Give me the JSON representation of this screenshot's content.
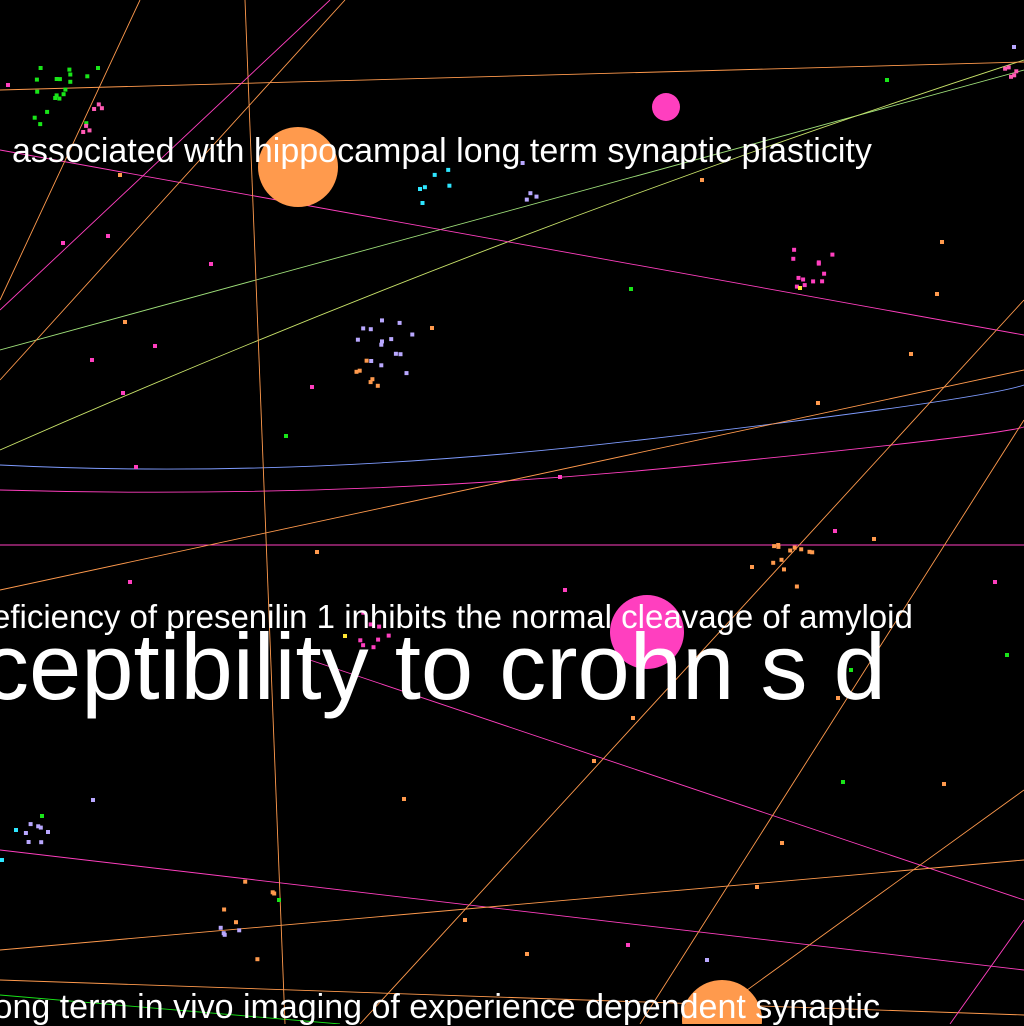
{
  "graph": {
    "background": "#000000",
    "palette": {
      "orange": "#ff9a4d",
      "magenta": "#ff3fbf",
      "green": "#19e619",
      "lavender": "#b9a8ff",
      "cyan": "#2ee6ff",
      "yellow": "#ffe633",
      "blue": "#7f9cff",
      "pink": "#ff5ab4"
    },
    "labels": [
      "associated with hippocampal long term synaptic plasticity",
      "eficiency of presenilin 1 inhibits the normal cleavage of amyloid",
      "ceptibility to crohn s d",
      "long term in vivo imaging of experience dependent synaptic"
    ]
  }
}
